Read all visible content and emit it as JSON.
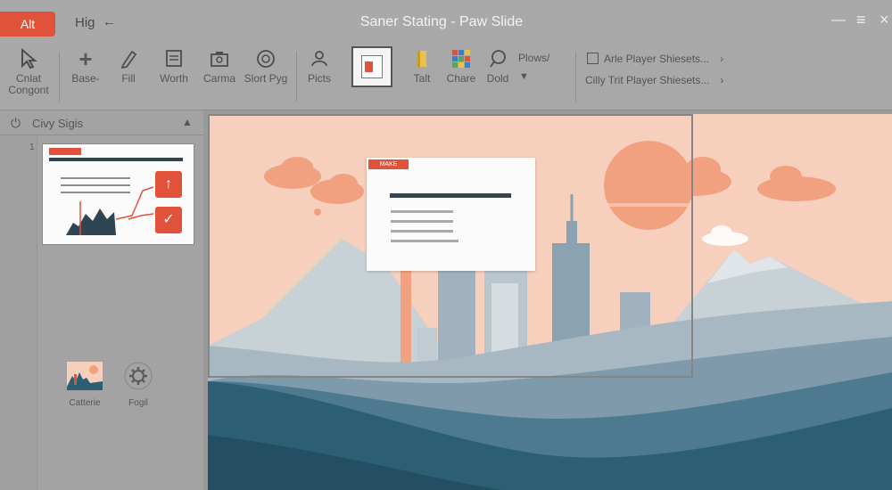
{
  "titlebar": {
    "app_button": "Alt",
    "menu_label": "Hig",
    "back_icon": "arrow-left-icon",
    "title": "Saner Stating - Paw Slide",
    "minimize_icon": "minimize-icon",
    "menu_icon": "hamburger-icon",
    "close_icon": "close-icon"
  },
  "ribbon": {
    "items": [
      {
        "label": "Cnlat Congont",
        "icon": "cursor-icon"
      },
      {
        "label": "Base-",
        "icon": "plus-icon"
      },
      {
        "label": "Fill",
        "icon": "pen-icon"
      },
      {
        "label": "Worth",
        "icon": "layout-icon"
      },
      {
        "label": "Carma",
        "icon": "camera-icon"
      },
      {
        "label": "Slort Pyg",
        "icon": "dial-icon"
      },
      {
        "label": "Picts",
        "icon": "picture-icon"
      },
      {
        "label": "Talt",
        "icon": "text-icon"
      },
      {
        "label": "Chare",
        "icon": "grid-icon"
      },
      {
        "label": "Dold",
        "icon": "lasso-icon"
      }
    ],
    "selected_item_icon": "presentation-icon",
    "plows_label": "Plows/",
    "right_items": [
      "Arle Player Shiesets...",
      "Cilly Trit Player Shiesets..."
    ]
  },
  "panel": {
    "title": "Civy Sigis",
    "power_icon": "power-icon",
    "collapse_icon": "chevron-up-icon",
    "slide_number": "1",
    "tools": [
      {
        "label": "Catterie",
        "icon": "landscape-thumb-icon"
      },
      {
        "label": "Fogil",
        "icon": "gear-icon"
      }
    ]
  },
  "slide": {
    "card_tag": "MAKE",
    "colors": {
      "sky": "#f6cfbd",
      "sun": "#f1a17f",
      "accent": "#e0533a",
      "navy": "#2f4553",
      "teal_dark": "#2c5f73"
    }
  }
}
